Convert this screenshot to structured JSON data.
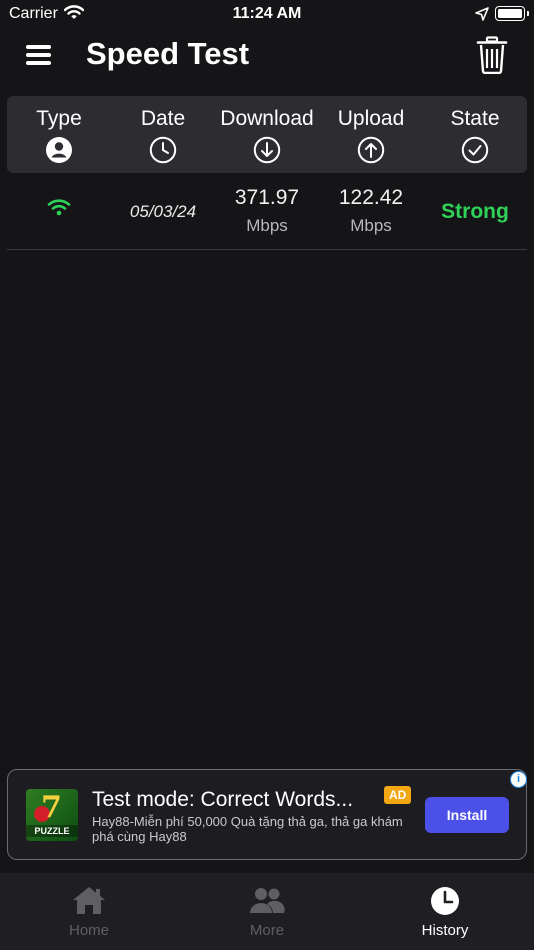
{
  "status_bar": {
    "carrier": "Carrier",
    "time": "11:24 AM"
  },
  "header": {
    "title": "Speed Test",
    "icons": [
      "menu-icon",
      "trash-icon"
    ]
  },
  "table": {
    "columns": [
      {
        "label": "Type",
        "icon": "user-circle-icon"
      },
      {
        "label": "Date",
        "icon": "clock-icon"
      },
      {
        "label": "Download",
        "icon": "arrow-down-circle-icon"
      },
      {
        "label": "Upload",
        "icon": "arrow-up-circle-icon"
      },
      {
        "label": "State",
        "icon": "check-circle-icon"
      }
    ],
    "rows": [
      {
        "type_icon": "wifi-icon",
        "date": "05/03/24",
        "download": "371.97",
        "download_unit": "Mbps",
        "upload": "122.42",
        "upload_unit": "Mbps",
        "state": "Strong",
        "state_color": "#30d158"
      }
    ]
  },
  "ad": {
    "title": "Test mode: Correct Words...",
    "badge": "AD",
    "description": "Hay88-Miễn phí 50,000 Quà tặng thả ga, thả ga khám phá cùng Hay88",
    "image_text": "PUZZLE",
    "image_number": "7",
    "button": "Install",
    "button_color": "#4a50e8"
  },
  "tab_bar": {
    "tabs": [
      {
        "label": "Home",
        "icon": "home-icon",
        "active": false
      },
      {
        "label": "More",
        "icon": "people-icon",
        "active": false
      },
      {
        "label": "History",
        "icon": "history-icon",
        "active": true
      }
    ]
  },
  "colors": {
    "background": "#151518",
    "header_bg": "#2c2c31",
    "accent_green": "#30d158",
    "tab_inactive": "#5e5e63"
  }
}
